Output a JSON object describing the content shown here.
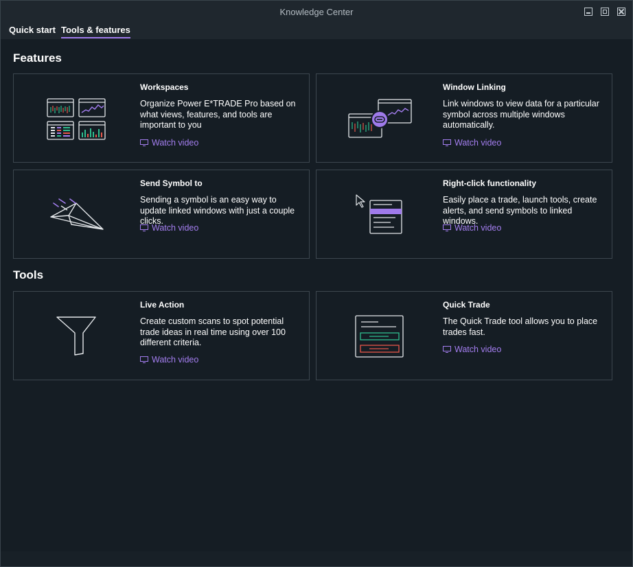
{
  "window": {
    "title": "Knowledge Center"
  },
  "tabs": [
    {
      "label": "Quick start"
    },
    {
      "label": "Tools & features"
    }
  ],
  "sections": {
    "features": {
      "heading": "Features"
    },
    "tools": {
      "heading": "Tools"
    }
  },
  "cards": [
    {
      "title": "Workspaces",
      "description": "Organize Power E*TRADE Pro based on what views, features, and tools are important to you",
      "link": "Watch video",
      "icon": "workspaces-illustration"
    },
    {
      "title": "Window Linking",
      "description": "Link windows to view data for a particular symbol across multiple windows automatically.",
      "link": "Watch video",
      "icon": "window-linking-illustration"
    },
    {
      "title": "Send Symbol to",
      "description": "Sending a symbol is an easy way to update linked windows with just a couple clicks.",
      "link": "Watch video",
      "icon": "paper-plane-illustration"
    },
    {
      "title": "Right-click functionality",
      "description": "Easily place a trade, launch tools, create alerts, and send symbols to linked windows.",
      "link": "Watch video",
      "icon": "context-menu-illustration"
    },
    {
      "title": "Live Action",
      "description": "Create custom scans to spot potential trade ideas in real time using over 100 different criteria.",
      "link": "Watch video",
      "icon": "funnel-illustration"
    },
    {
      "title": "Quick Trade",
      "description": "The Quick Trade tool allows you to place trades fast.",
      "link": "Watch video",
      "icon": "quick-trade-illustration"
    }
  ],
  "colors": {
    "accent": "#9f7aea",
    "background": "#151d24",
    "border": "#3d474f",
    "green": "#2fbf8f",
    "red": "#e8574a"
  }
}
